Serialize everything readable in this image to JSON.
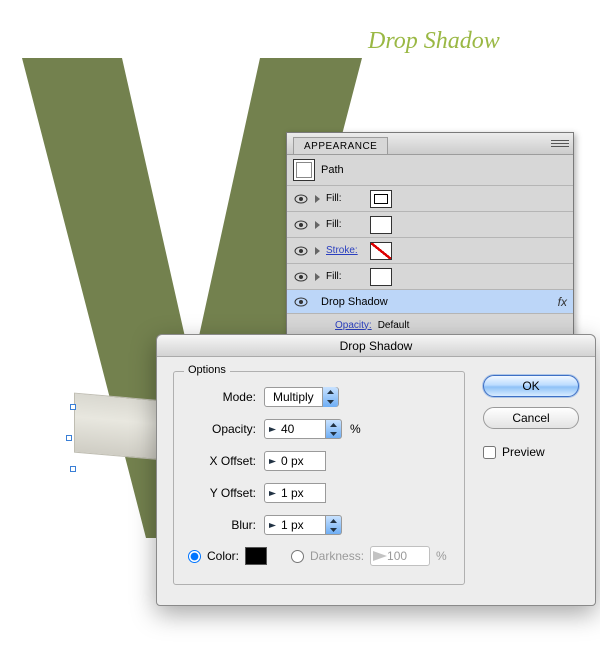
{
  "canvas": {
    "title": "Drop Shadow"
  },
  "appearance": {
    "tab": "APPEARANCE",
    "object_type": "Path",
    "rows": [
      {
        "label": "Fill:",
        "swatch": "pattern"
      },
      {
        "label": "Fill:",
        "swatch": "white"
      },
      {
        "label": "Stroke:",
        "swatch": "none",
        "link": true
      },
      {
        "label": "Fill:",
        "swatch": "white"
      }
    ],
    "effect": {
      "name": "Drop Shadow",
      "fx": "fx"
    },
    "opacity_row": {
      "label": "Opacity:",
      "value": "Default"
    }
  },
  "dialog": {
    "title": "Drop Shadow",
    "legend": "Options",
    "mode": {
      "label": "Mode:",
      "value": "Multiply"
    },
    "opacity": {
      "label": "Opacity:",
      "value": "40",
      "unit": "%"
    },
    "xoffset": {
      "label": "X Offset:",
      "value": "0 px"
    },
    "yoffset": {
      "label": "Y Offset:",
      "value": "1 px"
    },
    "blur": {
      "label": "Blur:",
      "value": "1 px"
    },
    "color_label": "Color:",
    "darkness_label": "Darkness:",
    "darkness_value": "100",
    "darkness_unit": "%",
    "ok": "OK",
    "cancel": "Cancel",
    "preview": "Preview"
  }
}
